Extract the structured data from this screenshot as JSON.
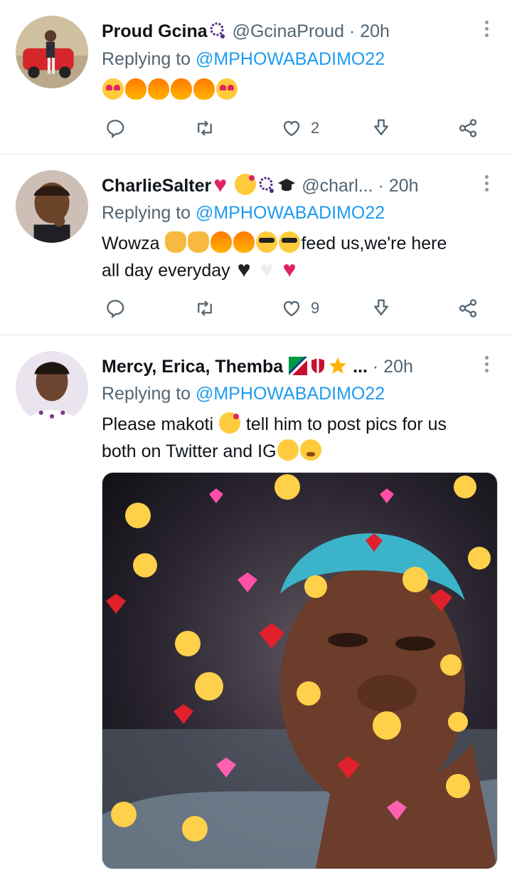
{
  "tweets": [
    {
      "name": "Proud Gcina",
      "handle": "@GcinaProud",
      "time": "20h",
      "reply_prefix": "Replying to",
      "reply_to": "@MPHOWABADIMO22",
      "text": "",
      "emojis": [
        "smiling-face-heart-eyes",
        "fire",
        "fire",
        "fire",
        "fire",
        "smiling-face-heart-eyes"
      ],
      "likes": "2"
    },
    {
      "name": "CharlieSalter",
      "handle": "@charl...",
      "time": "20h",
      "reply_prefix": "Replying to",
      "reply_to": "@MPHOWABADIMO22",
      "text_start": "Wowza",
      "text_mid": "feed us,we're here",
      "text_end": "all day everyday",
      "likes": "9"
    },
    {
      "name": "Mercy, Erica, Themba",
      "name_suffix": "...",
      "time": "20h",
      "reply_prefix": "Replying to",
      "reply_to": "@MPHOWABADIMO22",
      "line1_a": "Please makoti",
      "line1_b": "tell him to post pics for us",
      "line2": "both on Twitter and IG",
      "media": "photo-with-heart-emoji-filter"
    }
  ],
  "colors": {
    "link": "#1d9bf0",
    "muted": "#536471",
    "text": "#0f1419",
    "divider": "#e1e6ea"
  },
  "icons": [
    "reply-icon",
    "retweet-icon",
    "like-icon",
    "bookmark-icon",
    "share-icon",
    "more-icon"
  ]
}
